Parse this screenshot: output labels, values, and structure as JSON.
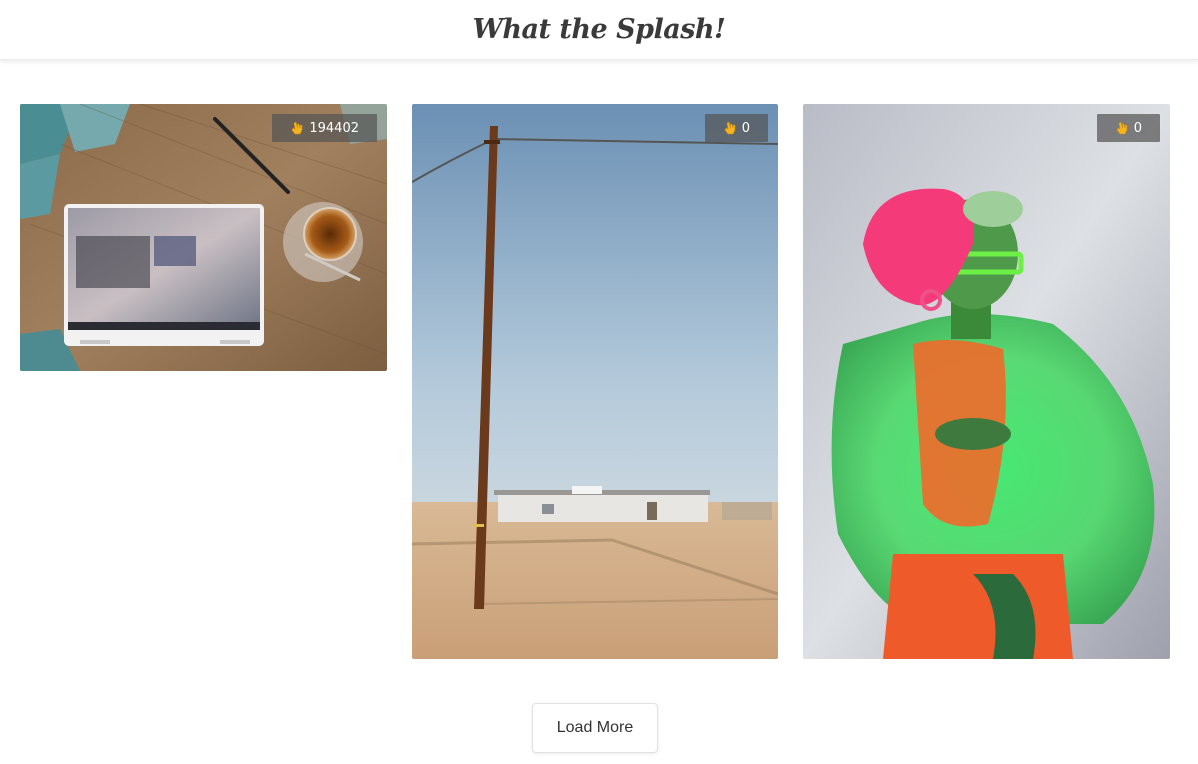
{
  "header": {
    "title": "What the Splash!"
  },
  "photos": [
    {
      "likes": "194402",
      "icon": "rock-on-hand-icon",
      "subject": "laptop-on-wooden-table"
    },
    {
      "likes": "0",
      "icon": "rock-on-hand-icon",
      "subject": "desert-utility-pole"
    },
    {
      "likes": "0",
      "icon": "rock-on-hand-icon",
      "subject": "neon-fashion-portrait"
    }
  ],
  "load_more": {
    "label": "Load More"
  },
  "colors": {
    "badge_bg": "#555555",
    "hand": "#f5b321",
    "title": "#3a3a3a"
  }
}
